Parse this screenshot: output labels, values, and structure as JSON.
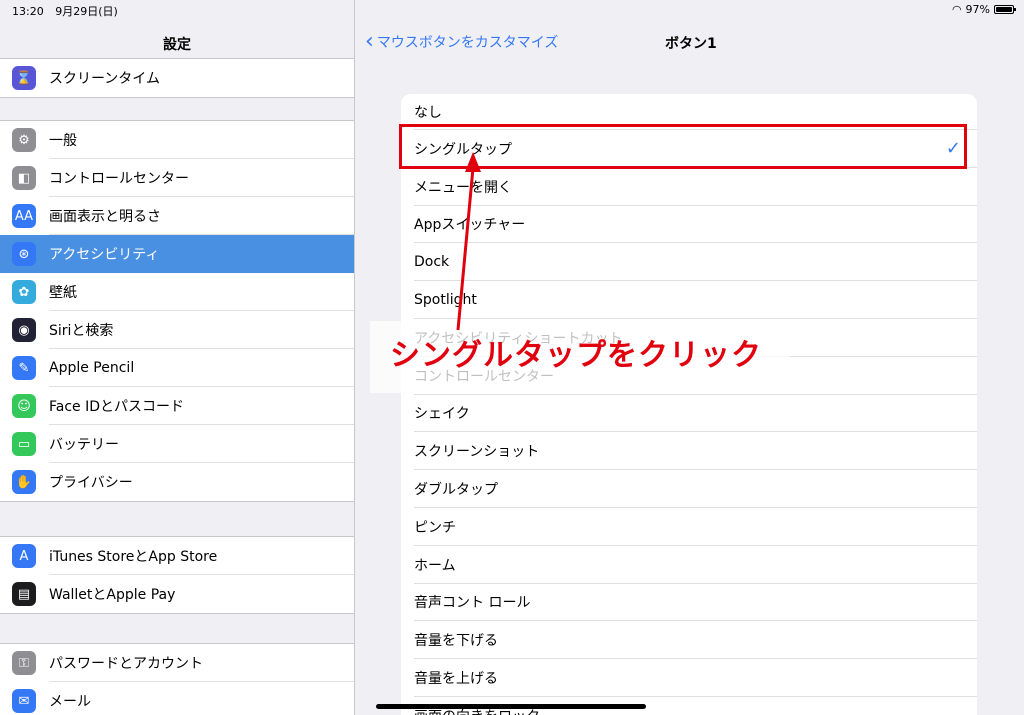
{
  "status": {
    "time": "13:20",
    "date": "9月29日(日)",
    "battery": "97%",
    "battery_level": 0.97
  },
  "sidebar": {
    "title": "設定",
    "groups": [
      [
        {
          "label": "スクリーンタイム",
          "icon": "hourglass-icon",
          "color": "#5856d6",
          "glyph": "⌛"
        }
      ],
      [
        {
          "label": "一般",
          "icon": "gear-icon",
          "color": "#8e8e93",
          "glyph": "⚙"
        },
        {
          "label": "コントロールセンター",
          "icon": "toggle-icon",
          "color": "#8e8e93",
          "glyph": "◧"
        },
        {
          "label": "画面表示と明るさ",
          "icon": "text-size-icon",
          "color": "#3478f6",
          "glyph": "AA"
        },
        {
          "label": "アクセシビリティ",
          "icon": "accessibility-icon",
          "color": "#3478f6",
          "glyph": "⊛",
          "selected": true
        },
        {
          "label": "壁紙",
          "icon": "flower-icon",
          "color": "#35aadc",
          "glyph": "✿"
        },
        {
          "label": "Siriと検索",
          "icon": "siri-icon",
          "color": "#222236",
          "glyph": "◉"
        },
        {
          "label": "Apple Pencil",
          "icon": "pencil-icon",
          "color": "#3478f6",
          "glyph": "✎"
        },
        {
          "label": "Face IDとパスコード",
          "icon": "faceid-icon",
          "color": "#34c759",
          "glyph": "☺"
        },
        {
          "label": "バッテリー",
          "icon": "battery-icon",
          "color": "#34c759",
          "glyph": "▭"
        },
        {
          "label": "プライバシー",
          "icon": "hand-icon",
          "color": "#3478f6",
          "glyph": "✋"
        }
      ],
      [
        {
          "label": "iTunes StoreとApp Store",
          "icon": "app-store-icon",
          "color": "#3478f6",
          "glyph": "A"
        },
        {
          "label": "WalletとApple Pay",
          "icon": "wallet-icon",
          "color": "#1c1c1e",
          "glyph": "▤"
        }
      ],
      [
        {
          "label": "パスワードとアカウント",
          "icon": "key-icon",
          "color": "#8e8e93",
          "glyph": "⚿"
        },
        {
          "label": "メール",
          "icon": "mail-icon",
          "color": "#3478f6",
          "glyph": "✉"
        }
      ]
    ]
  },
  "nav": {
    "back_label": "マウスボタンをカスタマイズ",
    "title": "ボタン1"
  },
  "options": [
    {
      "label": "なし"
    },
    {
      "label": "シングルタップ",
      "checked": true
    },
    {
      "label": "メニューを開く"
    },
    {
      "label": "Appスイッチャー"
    },
    {
      "label": "Dock"
    },
    {
      "label": "Spotlight"
    },
    {
      "label": "アクセシビリティショートカット"
    },
    {
      "label": "コントロールセンター"
    },
    {
      "label": "シェイク"
    },
    {
      "label": "スクリーンショット"
    },
    {
      "label": "ダブルタップ"
    },
    {
      "label": "ピンチ"
    },
    {
      "label": "ホーム"
    },
    {
      "label": "音声コント ロール"
    },
    {
      "label": "音量を下げる"
    },
    {
      "label": "音量を上げる"
    },
    {
      "label": "画面の向きをロック"
    }
  ],
  "annotation": {
    "text": "シングルタップをクリック",
    "color": "#e0000e"
  }
}
